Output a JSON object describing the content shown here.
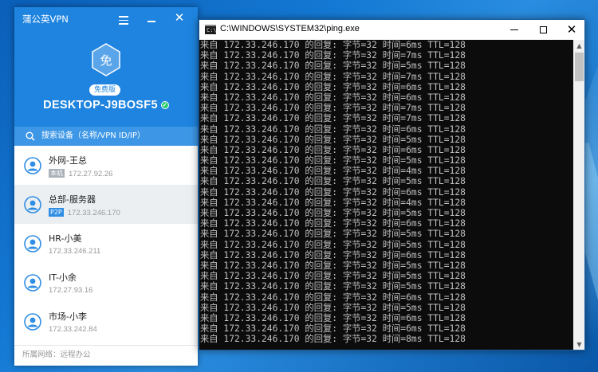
{
  "vpn": {
    "title": "蒲公英VPN",
    "logo_char": "免",
    "plan_badge": "免费版",
    "host_name": "DESKTOP-J9BOSF5",
    "search_placeholder": "搜索设备（名称/VPN ID/IP）",
    "peers": [
      {
        "name": "外网-王总",
        "tag": "本机",
        "ip": "172.27.92.26"
      },
      {
        "name": "总部-服务器",
        "tag": "P2P",
        "ip": "172.33.246.170"
      },
      {
        "name": "HR-小美",
        "tag": "",
        "ip": "172.33.246.211"
      },
      {
        "name": "IT-小余",
        "tag": "",
        "ip": "172.27.93.16"
      },
      {
        "name": "市场-小李",
        "tag": "",
        "ip": "172.33.242.84"
      }
    ],
    "footer_label": "所属网络：远程办公",
    "colors": {
      "accent": "#1e84df",
      "online": "#2ecc71",
      "p2p_tag": "#2f8de4",
      "local_tag": "#a9b0b7"
    }
  },
  "console": {
    "title": "C:\\WINDOWS\\SYSTEM32\\ping.exe",
    "lines": [
      "来自 172.33.246.170 的回复: 字节=32 时间=6ms TTL=128",
      "来自 172.33.246.170 的回复: 字节=32 时间=7ms TTL=128",
      "来自 172.33.246.170 的回复: 字节=32 时间=5ms TTL=128",
      "来自 172.33.246.170 的回复: 字节=32 时间=7ms TTL=128",
      "来自 172.33.246.170 的回复: 字节=32 时间=6ms TTL=128",
      "来自 172.33.246.170 的回复: 字节=32 时间=6ms TTL=128",
      "来自 172.33.246.170 的回复: 字节=32 时间=7ms TTL=128",
      "来自 172.33.246.170 的回复: 字节=32 时间=7ms TTL=128",
      "来自 172.33.246.170 的回复: 字节=32 时间=6ms TTL=128",
      "来自 172.33.246.170 的回复: 字节=32 时间=5ms TTL=128",
      "来自 172.33.246.170 的回复: 字节=32 时间=6ms TTL=128",
      "来自 172.33.246.170 的回复: 字节=32 时间=5ms TTL=128",
      "来自 172.33.246.170 的回复: 字节=32 时间=4ms TTL=128",
      "来自 172.33.246.170 的回复: 字节=32 时间=5ms TTL=128",
      "来自 172.33.246.170 的回复: 字节=32 时间=6ms TTL=128",
      "来自 172.33.246.170 的回复: 字节=32 时间=4ms TTL=128",
      "来自 172.33.246.170 的回复: 字节=32 时间=5ms TTL=128",
      "来自 172.33.246.170 的回复: 字节=32 时间=6ms TTL=128",
      "来自 172.33.246.170 的回复: 字节=32 时间=5ms TTL=128",
      "来自 172.33.246.170 的回复: 字节=32 时间=5ms TTL=128",
      "来自 172.33.246.170 的回复: 字节=32 时间=6ms TTL=128",
      "来自 172.33.246.170 的回复: 字节=32 时间=5ms TTL=128",
      "来自 172.33.246.170 的回复: 字节=32 时间=5ms TTL=128",
      "来自 172.33.246.170 的回复: 字节=32 时间=5ms TTL=128",
      "来自 172.33.246.170 的回复: 字节=32 时间=6ms TTL=128",
      "来自 172.33.246.170 的回复: 字节=32 时间=5ms TTL=128",
      "来自 172.33.246.170 的回复: 字节=32 时间=6ms TTL=128",
      "来自 172.33.246.170 的回复: 字节=32 时间=6ms TTL=128",
      "来自 172.33.246.170 的回复: 字节=32 时间=8ms TTL=128"
    ]
  }
}
